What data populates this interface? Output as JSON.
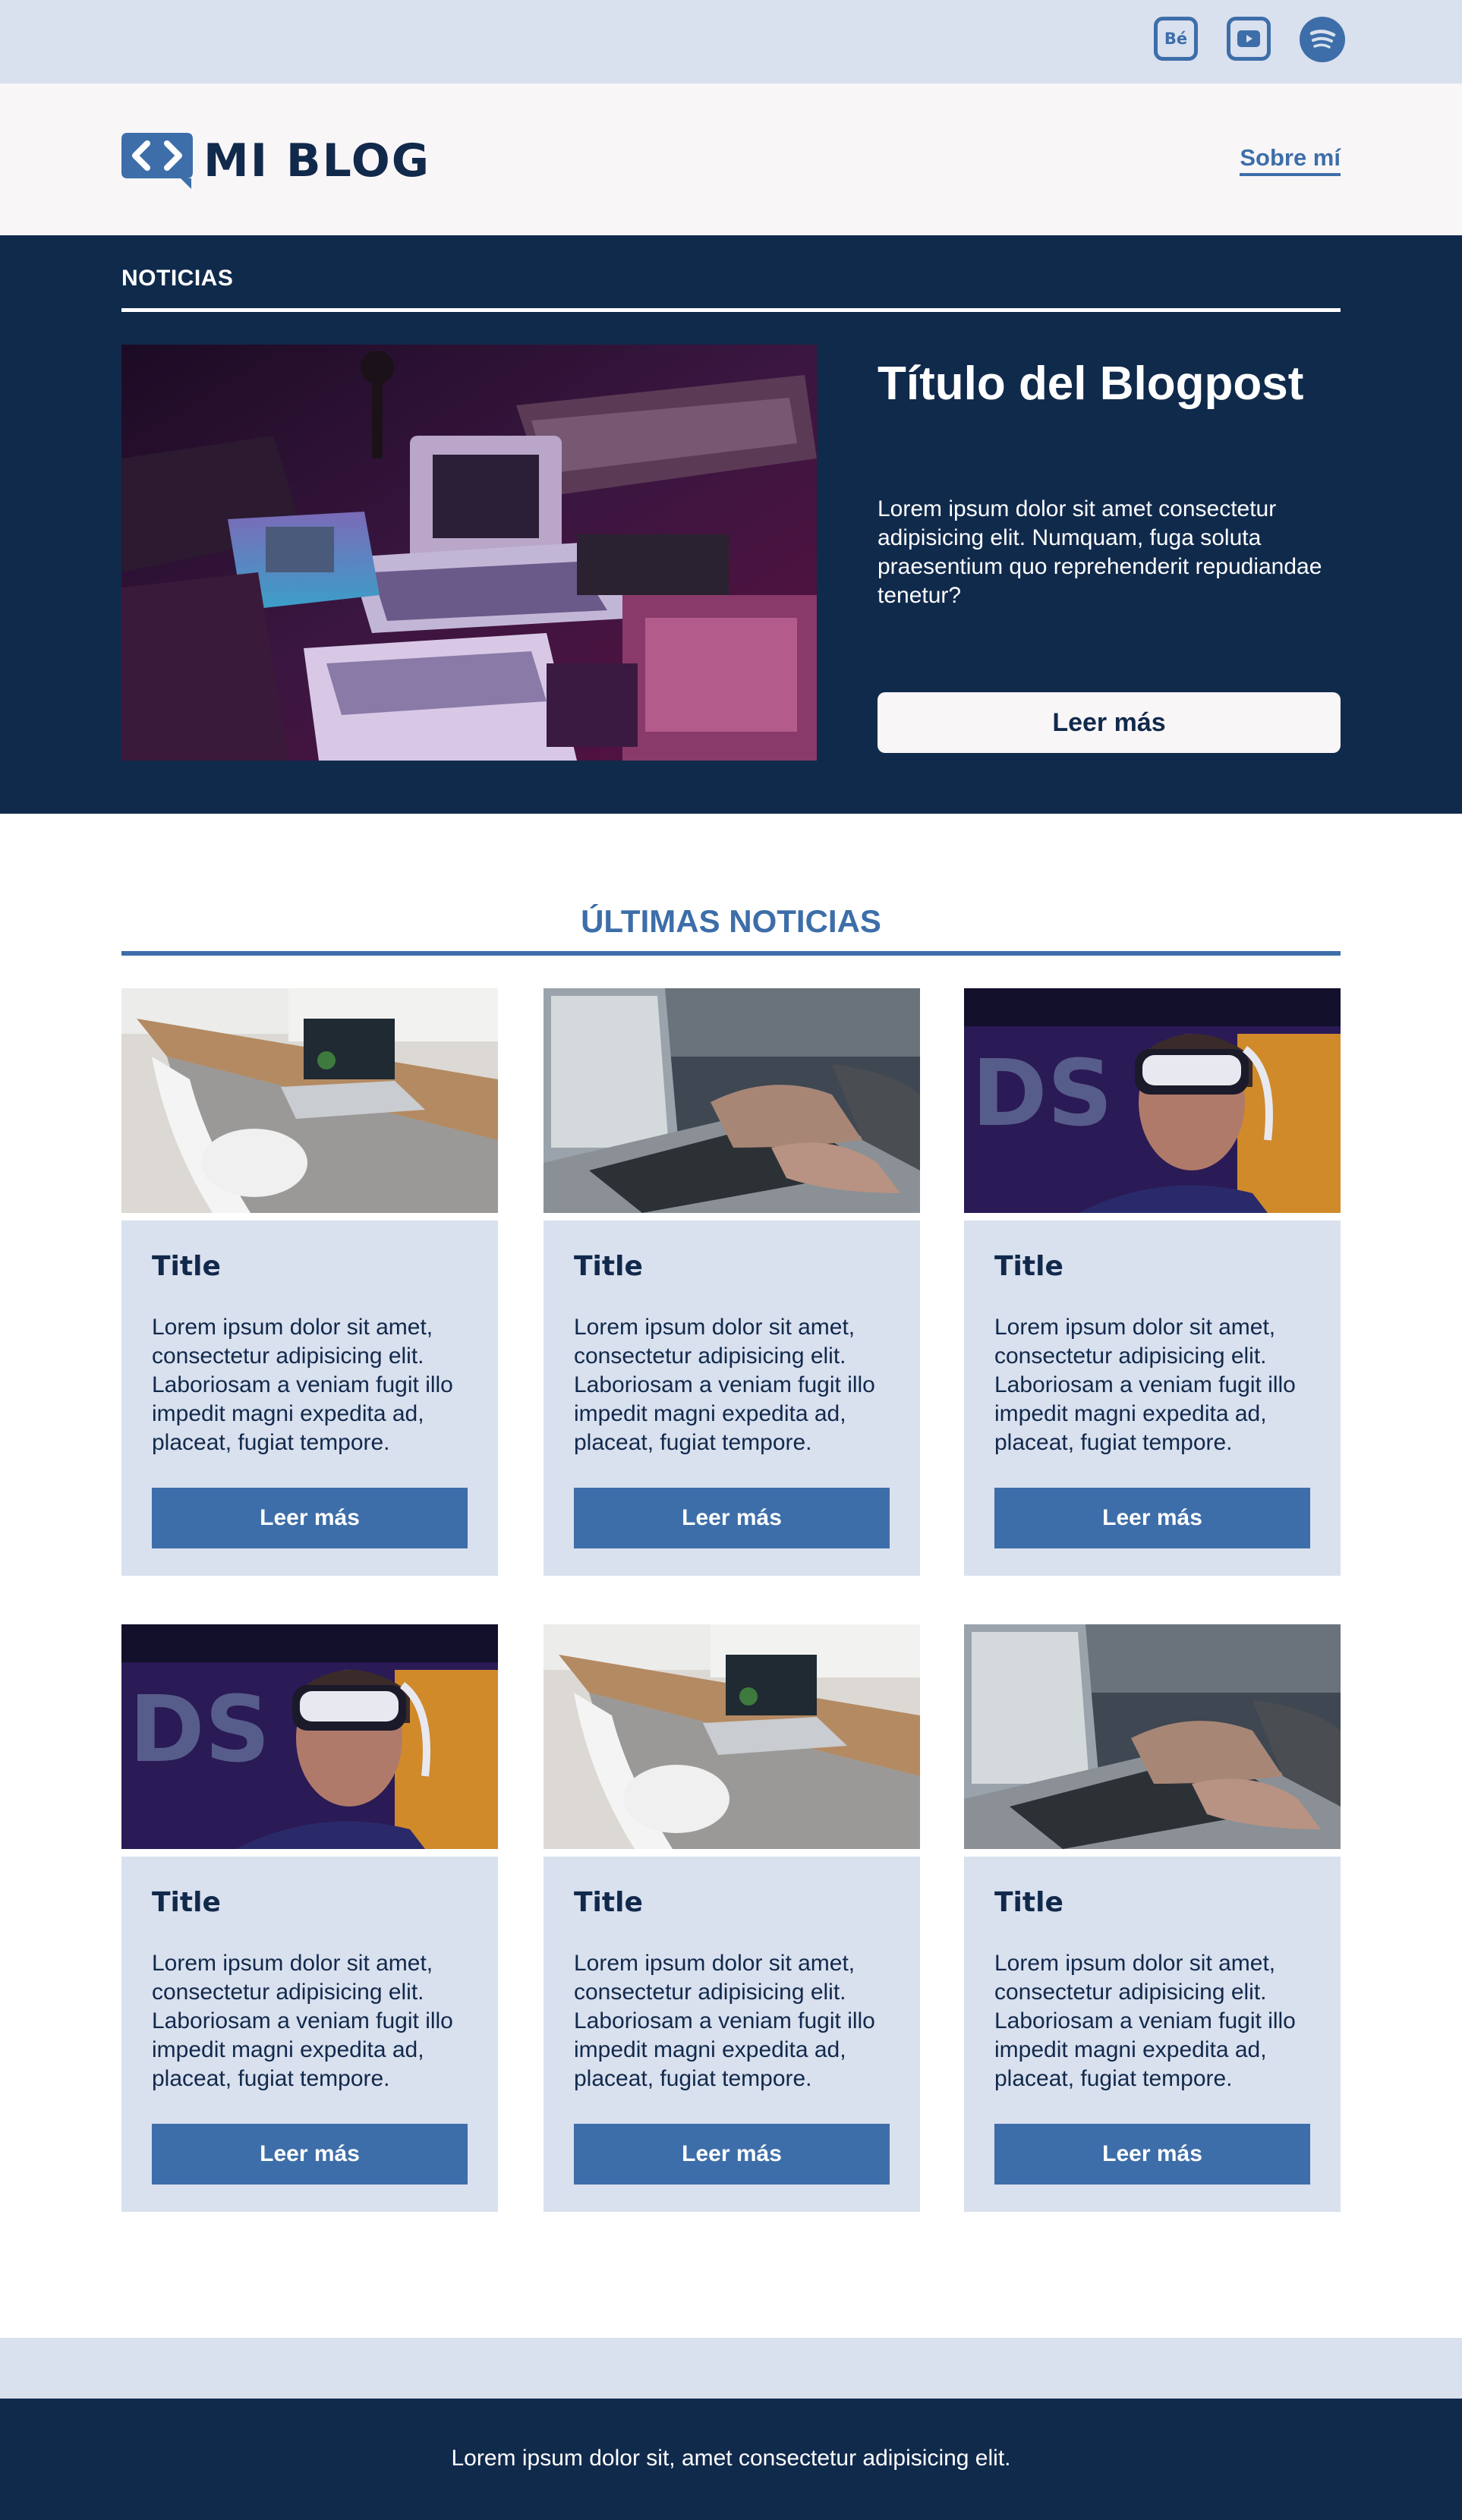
{
  "topbar": {
    "social": [
      {
        "icon": "behance-icon",
        "label": "Bé"
      },
      {
        "icon": "youtube-icon"
      },
      {
        "icon": "spotify-icon"
      }
    ]
  },
  "header": {
    "logo_text": "MI BLOG",
    "nav_link": "Sobre mí"
  },
  "hero": {
    "kicker": "NOTICIAS",
    "title": "Título del Blogpost",
    "text": "Lorem ipsum dolor sit amet consectetur adipisicing elit. Numquam, fuga soluta praesentium quo reprehenderit repudiandae tenetur?",
    "button": "Leer más",
    "image": "retro-computers-photo"
  },
  "latest": {
    "title": "ÚLTIMAS NOTICIAS",
    "cards": [
      {
        "image": "desk-laptop-photo",
        "title": "Title",
        "text": "Lorem ipsum dolor sit amet, consectetur adipisicing elit. Laboriosam a veniam fugit illo impedit magni expedita ad, placeat, fugiat tempore.",
        "button": "Leer más"
      },
      {
        "image": "typing-laptop-photo",
        "title": "Title",
        "text": "Lorem ipsum dolor sit amet, consectetur adipisicing elit. Laboriosam a veniam fugit illo impedit magni expedita ad, placeat, fugiat tempore.",
        "button": "Leer más"
      },
      {
        "image": "vr-headset-photo",
        "title": "Title",
        "text": "Lorem ipsum dolor sit amet, consectetur adipisicing elit. Laboriosam a veniam fugit illo impedit magni expedita ad, placeat, fugiat tempore.",
        "button": "Leer más"
      },
      {
        "image": "vr-headset-photo",
        "title": "Title",
        "text": "Lorem ipsum dolor sit amet, consectetur adipisicing elit. Laboriosam a veniam fugit illo impedit magni expedita ad, placeat, fugiat tempore.",
        "button": "Leer más"
      },
      {
        "image": "desk-laptop-photo",
        "title": "Title",
        "text": "Lorem ipsum dolor sit amet, consectetur adipisicing elit. Laboriosam a veniam fugit illo impedit magni expedita ad, placeat, fugiat tempore.",
        "button": "Leer más"
      },
      {
        "image": "typing-laptop-photo",
        "title": "Title",
        "text": "Lorem ipsum dolor sit amet, consectetur adipisicing elit. Laboriosam a veniam fugit illo impedit magni expedita ad, placeat, fugiat tempore.",
        "button": "Leer más"
      }
    ]
  },
  "footer": {
    "text": "Lorem ipsum dolor sit, amet consectetur adipisicing elit."
  },
  "colors": {
    "navy": "#102a4c",
    "accent": "#3d6ea9",
    "light": "#d9e0ee",
    "header_bg": "#f9f6f8"
  }
}
